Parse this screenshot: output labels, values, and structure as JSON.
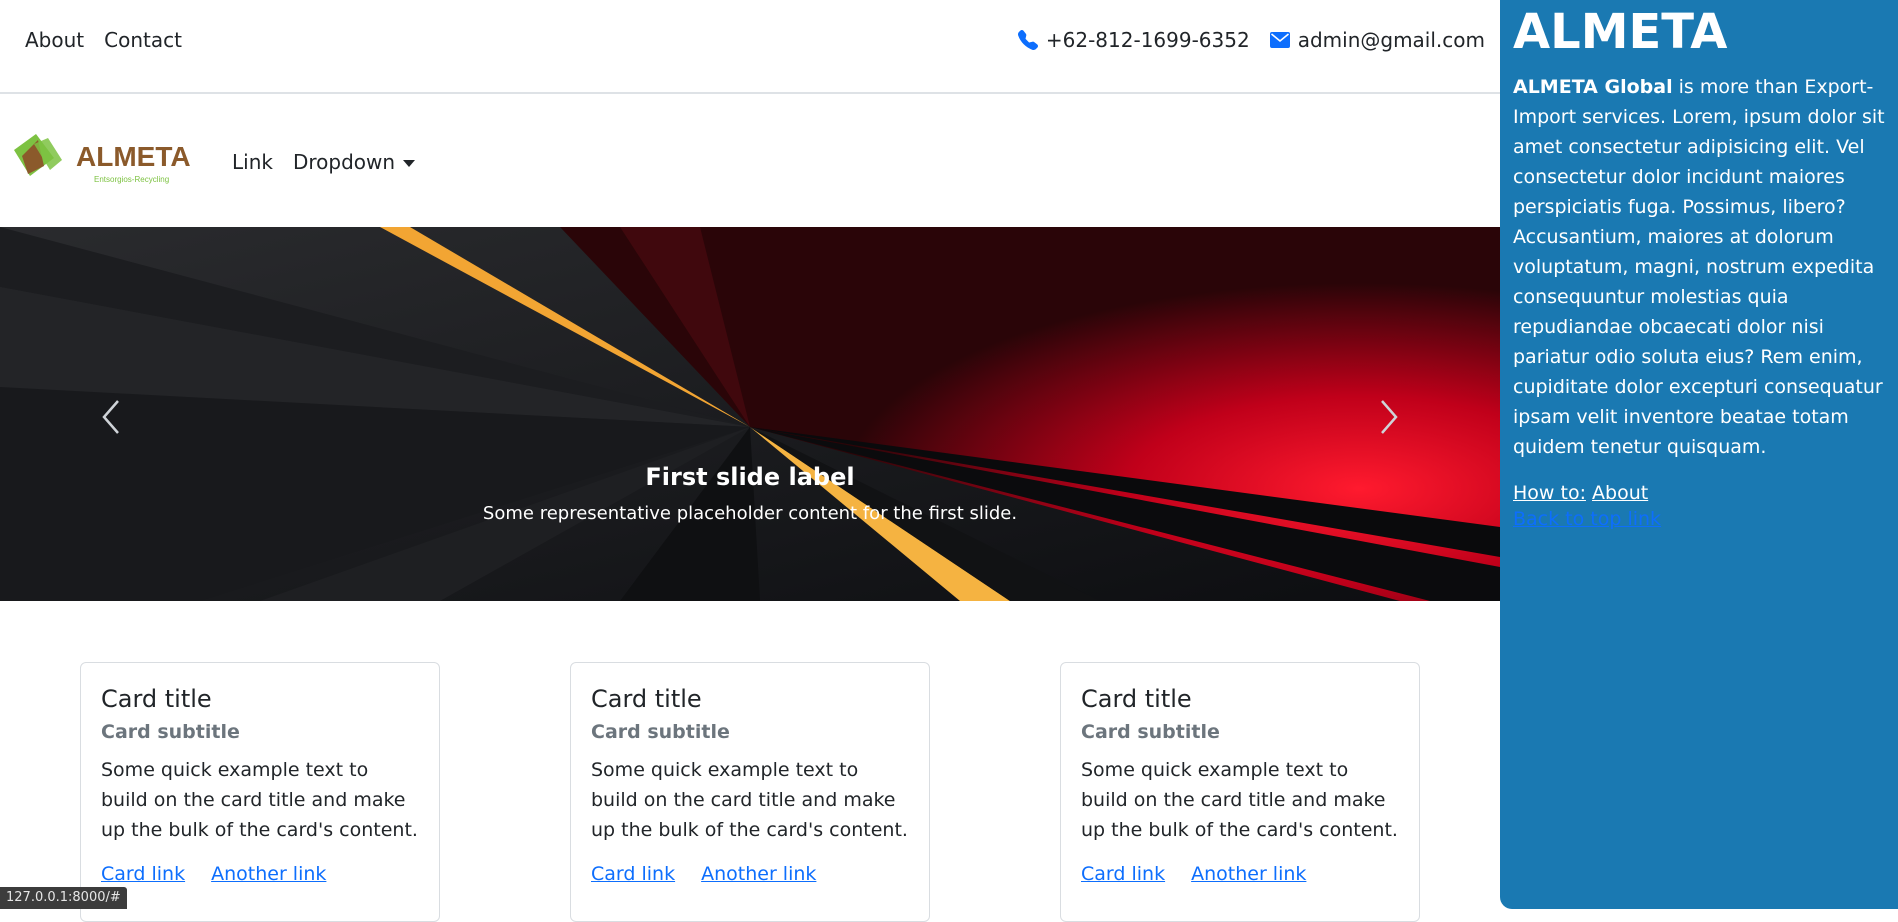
{
  "topbar": {
    "nav": [
      {
        "label": "About"
      },
      {
        "label": "Contact"
      }
    ],
    "phone": "+62-812-1699-6352",
    "email": "admin@gmail.com"
  },
  "navbar": {
    "logo_text": "ALMETA",
    "logo_tagline": "Entsorgios-Recycling",
    "link_label": "Link",
    "dropdown_label": "Dropdown"
  },
  "carousel": {
    "caption_title": "First slide label",
    "caption_text": "Some representative placeholder content for the first slide.",
    "prev_icon": "chevron-left-icon",
    "next_icon": "chevron-right-icon"
  },
  "cards": [
    {
      "title": "Card title",
      "subtitle": "Card subtitle",
      "text": "Some quick example text to build on the card title and make up the bulk of the card's content.",
      "link1": "Card link",
      "link2": "Another link"
    },
    {
      "title": "Card title",
      "subtitle": "Card subtitle",
      "text": "Some quick example text to build on the card title and make up the bulk of the card's content.",
      "link1": "Card link",
      "link2": "Another link"
    },
    {
      "title": "Card title",
      "subtitle": "Card subtitle",
      "text": "Some quick example text to build on the card title and make up the bulk of the card's content.",
      "link1": "Card link",
      "link2": "Another link"
    }
  ],
  "sidebar": {
    "brand": "ALMETA",
    "desc_bold": "ALMETA Global",
    "desc_rest": " is more than Export-Import services. Lorem, ipsum dolor sit amet consectetur adipisicing elit. Vel consectetur dolor incidunt maiores perspiciatis fuga. Possimus, libero? Accusantium, maiores at dolorum voluptatum, magni, nostrum expedita consequuntur molestias quia repudiandae obcaecati dolor nisi pariatur odio soluta eius? Rem enim, cupiditate dolor excepturi consequatur ipsam velit inventore beatae totam quidem tenetur quisquam.",
    "howto_label": "How to:",
    "howto_link": "About",
    "back_link": "Back to top link"
  },
  "statusbar": {
    "url": "127.0.0.1:8000/#"
  },
  "colors": {
    "sidebar_bg": "#1a79b2",
    "link": "#0d6efd",
    "logo_green": "#7dc242",
    "logo_brown": "#8b5a2b"
  }
}
